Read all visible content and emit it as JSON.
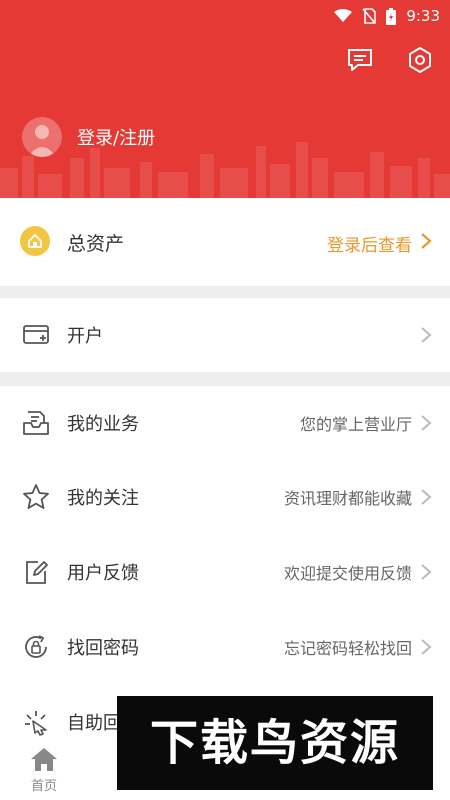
{
  "status_bar": {
    "time": "9:33",
    "icons": [
      "wifi-icon",
      "no-sim-icon",
      "battery-charging-icon"
    ]
  },
  "header": {
    "icons": [
      "message-icon",
      "settings-icon"
    ],
    "login_label": "登录/注册",
    "accent_color": "#e53935"
  },
  "assets": {
    "label": "总资产",
    "action": "登录后查看"
  },
  "menu": [
    {
      "label": "开户",
      "sub": ""
    },
    {
      "label": "我的业务",
      "sub": "您的掌上营业厅"
    },
    {
      "label": "我的关注",
      "sub": "资讯理财都能收藏"
    },
    {
      "label": "用户反馈",
      "sub": "欢迎提交使用反馈"
    },
    {
      "label": "找回密码",
      "sub": "忘记密码轻松找回"
    },
    {
      "label": "自助回",
      "sub": ""
    }
  ],
  "tabbar": {
    "home_label": "首页"
  },
  "watermark": {
    "text": "下载鸟资源"
  }
}
